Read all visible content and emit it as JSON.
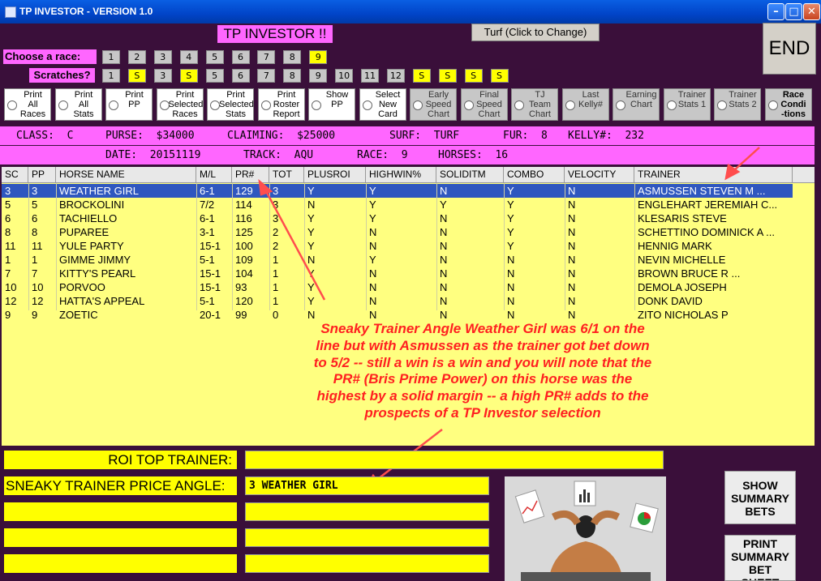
{
  "window": {
    "title": "TP INVESTOR - VERSION 1.0",
    "min_glyph": "–",
    "max_glyph": "□",
    "close_glyph": "✕"
  },
  "header": {
    "app_title": "TP INVESTOR !!",
    "turf_button": "Turf (Click to Change)",
    "end_button": "END"
  },
  "race_select": {
    "label": "Choose  a race:",
    "buttons": [
      "1",
      "2",
      "3",
      "4",
      "5",
      "6",
      "7",
      "8",
      "9"
    ],
    "selected": "9"
  },
  "scratches": {
    "label": "Scratches?",
    "buttons": [
      "1",
      "S",
      "3",
      "S",
      "5",
      "6",
      "7",
      "8",
      "9",
      "10",
      "11",
      "12",
      "S",
      "S",
      "S",
      "S"
    ]
  },
  "options": [
    "Print\nAll\nRaces",
    "Print\nAll\nStats",
    "Print\nPP",
    "Print\nSelected\nRaces",
    "Print\nSelected\nStats",
    "Print\nRoster\nReport",
    "Show\nPP",
    "Select\nNew\nCard",
    "Early\nSpeed\nChart",
    "Final\nSpeed\nChart",
    "TJ\nTeam\nChart",
    "Last\nKelly#",
    "Earning\nChart",
    "Trainer\nStats 1",
    "Trainer\nStats 2",
    "Race\nCondi\n-tions"
  ],
  "race_info": {
    "class": "CLASS:  C",
    "purse": "PURSE:  $34000",
    "claiming": "CLAIMING:  $25000",
    "surf": "SURF:  TURF",
    "fur": "FUR:  8",
    "kelly": "KELLY#:  232",
    "date": "DATE:  20151119",
    "track": "TRACK:  AQU",
    "race": "RACE:  9",
    "horses": "HORSES:  16"
  },
  "table": {
    "columns": [
      "SC",
      "PP",
      "HORSE NAME",
      "M/L",
      "PR#",
      "TOT",
      "PLUSROI",
      "HIGHWIN%",
      "SOLIDITM",
      "COMBO",
      "VELOCITY",
      "TRAINER"
    ],
    "rows": [
      [
        "3",
        "3",
        "WEATHER GIRL",
        "6-1",
        "129",
        "3",
        "Y",
        "Y",
        "N",
        "Y",
        "N",
        "ASMUSSEN STEVEN M     ..."
      ],
      [
        "5",
        "5",
        "BROCKOLINI",
        "7/2",
        "114",
        "3",
        "N",
        "Y",
        "Y",
        "Y",
        "N",
        "ENGLEHART JEREMIAH C..."
      ],
      [
        "6",
        "6",
        "TACHIELLO",
        "6-1",
        "116",
        "3",
        "Y",
        "Y",
        "N",
        "Y",
        "N",
        "KLESARIS STEVE"
      ],
      [
        "8",
        "8",
        "PUPAREE",
        "3-1",
        "125",
        "2",
        "Y",
        "N",
        "N",
        "Y",
        "N",
        "SCHETTINO DOMINICK A  ..."
      ],
      [
        "11",
        "11",
        "YULE PARTY",
        "15-1",
        "100",
        "2",
        "Y",
        "N",
        "N",
        "Y",
        "N",
        "HENNIG MARK"
      ],
      [
        "1",
        "1",
        "GIMME JIMMY",
        "5-1",
        "109",
        "1",
        "N",
        "Y",
        "N",
        "N",
        "N",
        "NEVIN MICHELLE"
      ],
      [
        "7",
        "7",
        "KITTY'S PEARL",
        "15-1",
        "104",
        "1",
        "Y",
        "N",
        "N",
        "N",
        "N",
        "BROWN BRUCE R          ..."
      ],
      [
        "10",
        "10",
        "PORVOO",
        "15-1",
        "93",
        "1",
        "Y",
        "N",
        "N",
        "N",
        "N",
        "DEMOLA JOSEPH"
      ],
      [
        "12",
        "12",
        "HATTA'S APPEAL",
        "5-1",
        "120",
        "1",
        "Y",
        "N",
        "N",
        "N",
        "N",
        "DONK DAVID"
      ],
      [
        "9",
        "9",
        "ZOETIC",
        "20-1",
        "99",
        "0",
        "N",
        "N",
        "N",
        "N",
        "N",
        "ZITO NICHOLAS P"
      ]
    ]
  },
  "annotation": "Sneaky Trainer Angle Weather Girl was 6/1 on the line but with Asmussen as the trainer got bet down to 5/2 -- still a win is a win and you will note that the PR# (Bris Prime Power) on this horse was the highest by a solid margin -- a high PR# adds to the prospects of a TP Investor selection",
  "bottom": {
    "roi_label": "ROI TOP TRAINER:",
    "roi_value": "",
    "sneaky_label": "SNEAKY TRAINER PRICE ANGLE:",
    "sneaky_value": "3 WEATHER GIRL"
  },
  "side_buttons": {
    "show": "SHOW\nSUMMARY\nBETS",
    "print": "PRINT\nSUMMARY\nBET\nSHEET"
  },
  "colors": {
    "background": "#3a0f3a",
    "magenta": "#ff66ff",
    "yellow": "#ffff00",
    "selection": "#2f57bf",
    "annotation": "#ff2020"
  }
}
